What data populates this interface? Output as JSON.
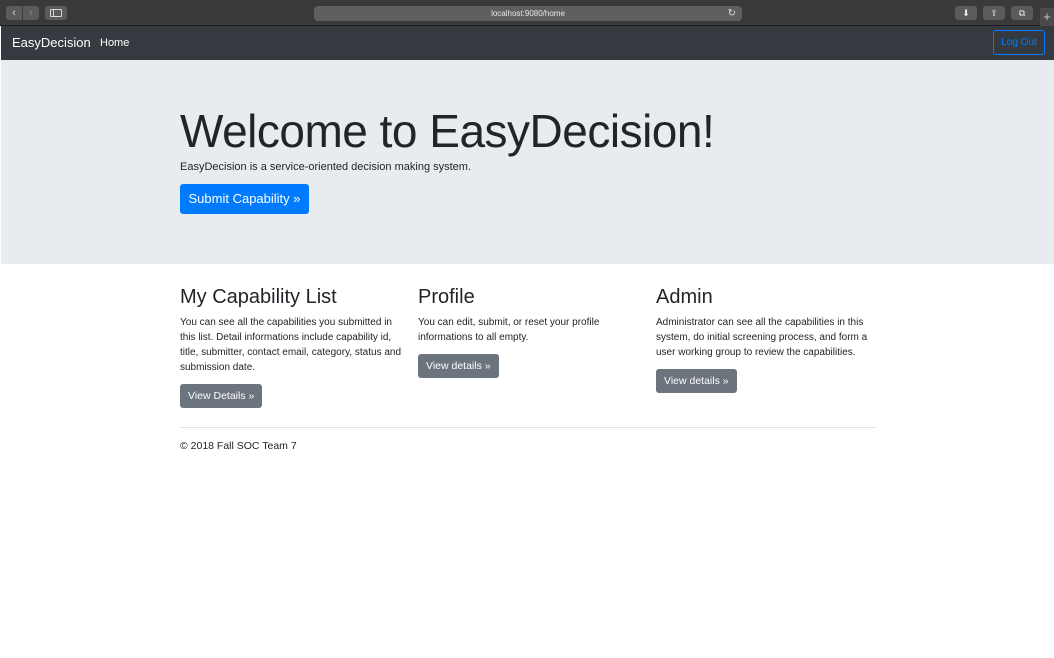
{
  "browser": {
    "url": "localhost:9080/home",
    "back_icon": "chevron-left-icon",
    "forward_icon": "chevron-right-icon"
  },
  "navbar": {
    "brand": "EasyDecision",
    "home": "Home",
    "logout": "Log Out",
    "logout_color": "#007bff",
    "bg_color": "#343a40"
  },
  "hero": {
    "title": "Welcome to EasyDecision!",
    "subtitle": "EasyDecision is a service-oriented decision making system.",
    "button": "Submit Capability »",
    "button_color": "#007bff"
  },
  "columns": [
    {
      "title": "My Capability List",
      "text": "You can see all the capabilities you submitted in this list. Detail informations include capability id, title, submitter, contact email, category, status and submission date.",
      "button": "View Details »"
    },
    {
      "title": "Profile",
      "text": "You can edit, submit, or reset your profile informations to all empty.",
      "button": "View details »"
    },
    {
      "title": "Admin",
      "text": "Administrator can see all the capabilities in this system, do initial screening process, and form a user working group to review the capabilities.",
      "button": "View details »"
    }
  ],
  "footer": {
    "text": "© 2018 Fall SOC Team 7"
  }
}
